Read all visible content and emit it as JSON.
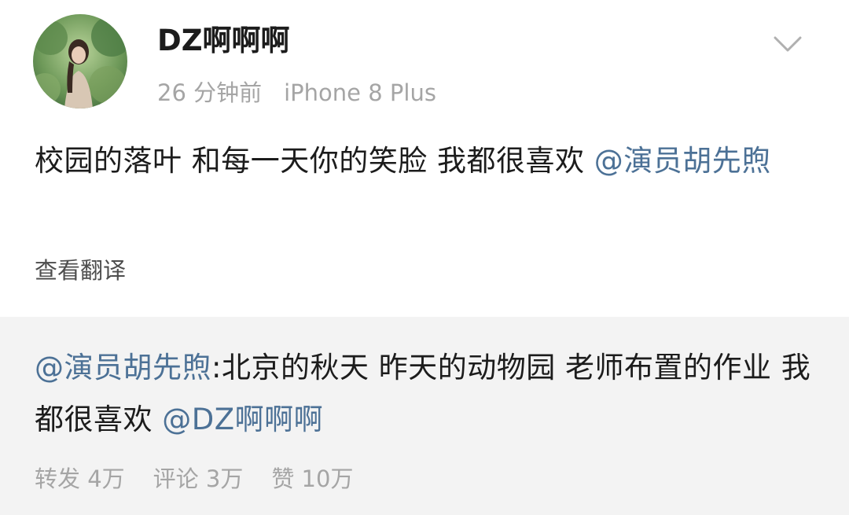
{
  "post": {
    "username": "DZ啊啊啊",
    "time": "26 分钟前",
    "device": "iPhone 8 Plus",
    "text": "校园的落叶 和每一天你的笑脸 我都很喜欢 ",
    "mention": "@演员胡先煦",
    "translate_label": "查看翻译"
  },
  "repost": {
    "mention": "@演员胡先煦",
    "text": ":北京的秋天 昨天的动物园 老师布置的作业 我都很喜欢 ",
    "mention_tail": "@DZ啊啊啊",
    "stats": {
      "forward": "转发 4万",
      "comment": "评论 3万",
      "like": "赞 10万"
    }
  },
  "icons": {
    "avatar": "avatar-photo-icon",
    "menu": "chevron-down-icon"
  },
  "colors": {
    "link": "#4c7196",
    "muted": "#a5a5a5",
    "repost_bg": "#f3f3f3"
  }
}
